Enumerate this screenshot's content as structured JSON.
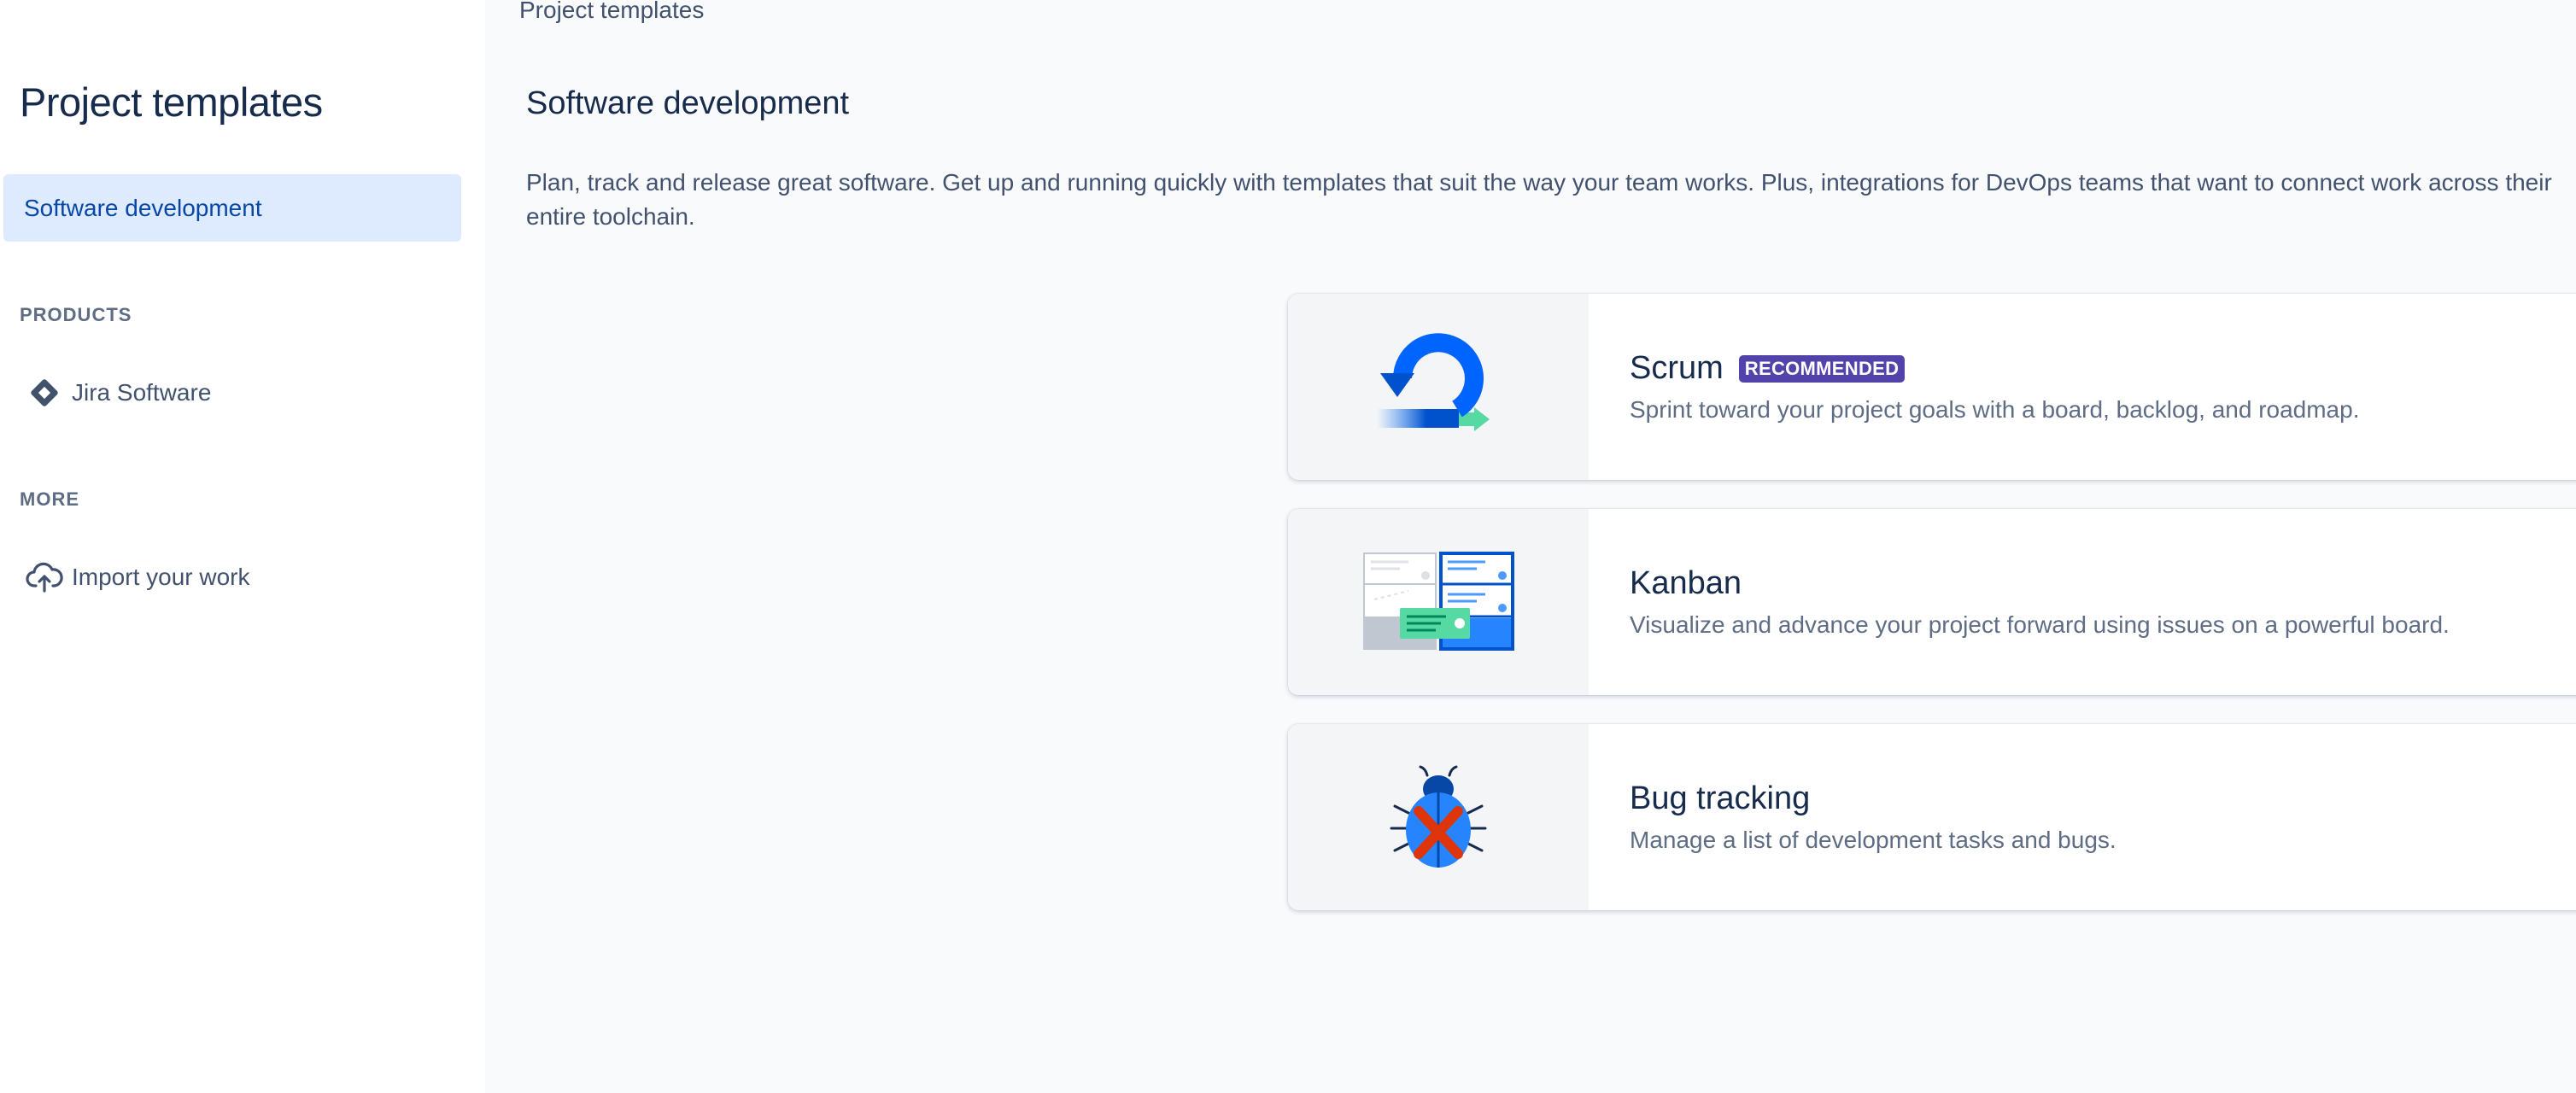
{
  "sidebar": {
    "title": "Project templates",
    "selected_item": "Software development",
    "sections": [
      {
        "label": "PRODUCTS",
        "items": [
          {
            "label": "Jira Software",
            "icon": "jira-diamond-icon"
          }
        ]
      },
      {
        "label": "MORE",
        "items": [
          {
            "label": "Import your work",
            "icon": "cloud-upload-icon"
          }
        ]
      }
    ]
  },
  "main": {
    "breadcrumb": "Project templates",
    "title": "Software development",
    "description": "Plan, track and release great software. Get up and running quickly with templates that suit the way your team works. Plus, integrations for DevOps teams that want to connect work across their entire toolchain.",
    "templates": [
      {
        "name": "Scrum",
        "badge": "RECOMMENDED",
        "description": "Sprint toward your project goals with a board, backlog, and roadmap.",
        "icon": "scrum-cycle-illustration"
      },
      {
        "name": "Kanban",
        "description": "Visualize and advance your project forward using issues on a powerful board.",
        "icon": "kanban-board-illustration"
      },
      {
        "name": "Bug tracking",
        "description": "Manage a list of development tasks and bugs.",
        "icon": "bug-illustration"
      }
    ]
  },
  "colors": {
    "selected_bg": "#deebff",
    "selected_text": "#0747a6",
    "badge_bg": "#5243aa",
    "main_bg": "#f9fafc"
  }
}
